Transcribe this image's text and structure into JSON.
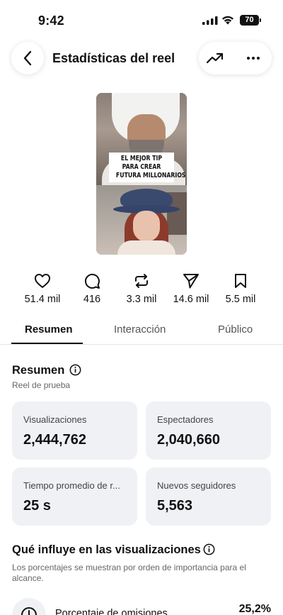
{
  "status_bar": {
    "time": "9:42",
    "battery": "70"
  },
  "header": {
    "title": "Estadísticas del reel",
    "icons": [
      "back-arrow-icon",
      "trending-up-icon",
      "more-horizontal-icon"
    ]
  },
  "thumbnail": {
    "caption_lines": [
      "EL MEJOR TIP",
      "PARA CREAR",
      "FUTURA MILLONARIOS"
    ]
  },
  "engagement": [
    {
      "icon": "heart-icon",
      "value": "51.4 mil"
    },
    {
      "icon": "comment-icon",
      "value": "416"
    },
    {
      "icon": "repost-icon",
      "value": "3.3 mil"
    },
    {
      "icon": "share-icon",
      "value": "14.6 mil"
    },
    {
      "icon": "bookmark-icon",
      "value": "5.5 mil"
    }
  ],
  "tabs": [
    {
      "label": "Resumen",
      "active": true
    },
    {
      "label": "Interacción",
      "active": false
    },
    {
      "label": "Público",
      "active": false
    }
  ],
  "summary": {
    "title": "Resumen",
    "subtitle": "Reel de prueba",
    "cards": [
      {
        "label": "Visualizaciones",
        "value": "2,444,762"
      },
      {
        "label": "Espectadores",
        "value": "2,040,660"
      },
      {
        "label": "Tiempo promedio de r...",
        "value": "25 s"
      },
      {
        "label": "Nuevos seguidores",
        "value": "5,563"
      }
    ]
  },
  "influence": {
    "title": "Qué influye en las visualizaciones",
    "description": "Los porcentajes se muestran por orden de importancia para el alcance.",
    "factors": [
      {
        "label": "Porcentaje de omisiones",
        "value": "25,2%",
        "icon": "clock-icon"
      }
    ]
  },
  "colors": {
    "text": "#111111",
    "muted": "#666666",
    "card_bg": "#eff1f4",
    "divider": "#e3e3e3"
  }
}
